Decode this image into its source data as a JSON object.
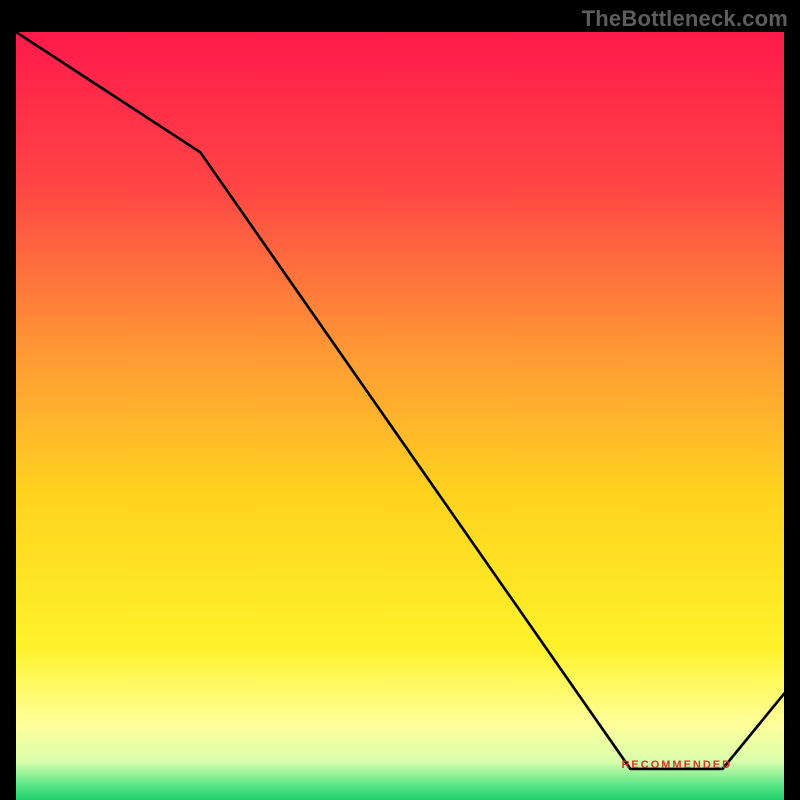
{
  "watermark": "TheBottleneck.com",
  "bottom_label": "RECOMMENDED",
  "chart_data": {
    "type": "line",
    "title": "",
    "xlabel": "",
    "ylabel": "",
    "xlim": [
      0,
      100
    ],
    "ylim": [
      0,
      100
    ],
    "x": [
      0,
      24,
      80,
      92,
      100
    ],
    "values": [
      100,
      84,
      2,
      2,
      12
    ],
    "gradient_stops": [
      {
        "pos": 0.0,
        "color": "#ff1a4b"
      },
      {
        "pos": 0.2,
        "color": "#ff4545"
      },
      {
        "pos": 0.42,
        "color": "#ff9a35"
      },
      {
        "pos": 0.6,
        "color": "#ffd21f"
      },
      {
        "pos": 0.8,
        "color": "#fff22a"
      },
      {
        "pos": 0.9,
        "color": "#ffff9a"
      },
      {
        "pos": 0.95,
        "color": "#d9ffab"
      },
      {
        "pos": 0.98,
        "color": "#5de68a"
      },
      {
        "pos": 1.0,
        "color": "#1fce6b"
      }
    ],
    "recommended_range": [
      80,
      92
    ]
  }
}
